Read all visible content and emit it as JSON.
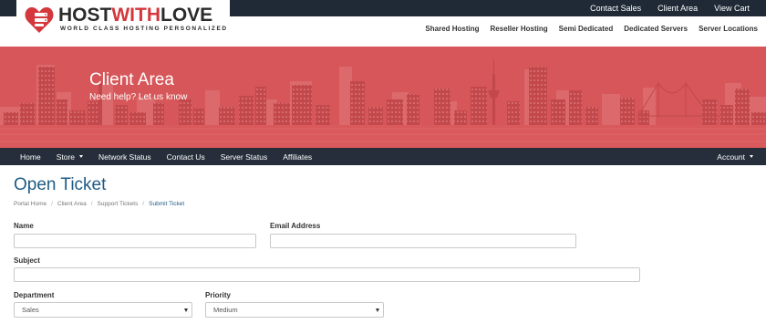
{
  "topbar": {
    "links": [
      "Contact Sales",
      "Client Area",
      "View Cart"
    ]
  },
  "logo": {
    "title_dark": "HOST",
    "title_red": "WITH",
    "title_dark2": "LOVE",
    "subtitle": "WORLD CLASS HOSTING PERSONALIZED",
    "icon": "heart-server-icon"
  },
  "subnav": {
    "links": [
      "Shared Hosting",
      "Reseller Hosting",
      "Semi Dedicated",
      "Dedicated Servers",
      "Server Locations"
    ]
  },
  "banner": {
    "title": "Client Area",
    "subtitle": "Need help? Let us know"
  },
  "mainnav": {
    "items": [
      {
        "label": "Home",
        "dropdown": false
      },
      {
        "label": "Store",
        "dropdown": true
      },
      {
        "label": "Network Status",
        "dropdown": false
      },
      {
        "label": "Contact Us",
        "dropdown": false
      },
      {
        "label": "Server Status",
        "dropdown": false
      },
      {
        "label": "Affiliates",
        "dropdown": false
      }
    ],
    "account": "Account"
  },
  "page": {
    "title": "Open Ticket",
    "breadcrumb": [
      "Portal Home",
      "Client Area",
      "Support Tickets",
      "Submit Ticket"
    ]
  },
  "form": {
    "name_label": "Name",
    "name_value": "",
    "email_label": "Email Address",
    "email_value": "",
    "subject_label": "Subject",
    "subject_value": "",
    "department_label": "Department",
    "department_value": "Sales",
    "priority_label": "Priority",
    "priority_value": "Medium"
  },
  "colors": {
    "topbar": "#1f2a36",
    "banner": "#d65659",
    "mainnav": "#252e3a",
    "accent": "#1f5b86",
    "brand_red": "#d4373c"
  }
}
